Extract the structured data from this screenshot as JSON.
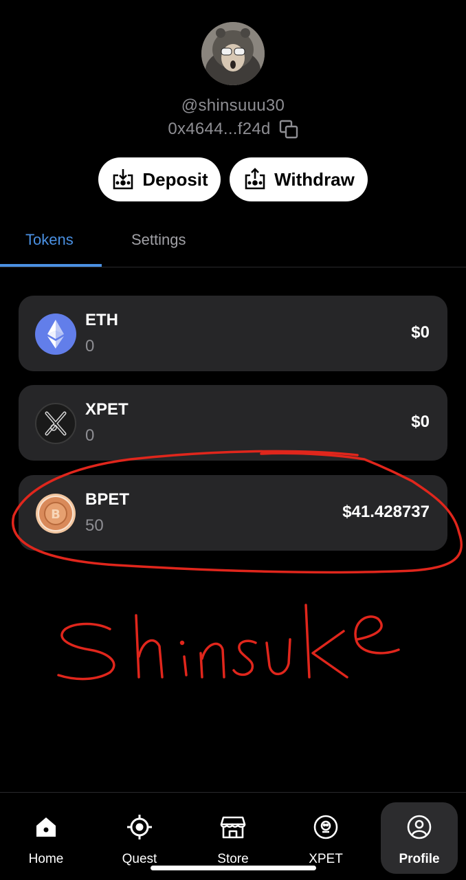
{
  "profile": {
    "username": "@shinsuuu30",
    "address": "0x4644...f24d"
  },
  "actions": {
    "deposit_label": "Deposit",
    "withdraw_label": "Withdraw"
  },
  "tabs": [
    {
      "label": "Tokens",
      "active": true
    },
    {
      "label": "Settings",
      "active": false
    }
  ],
  "tokens": [
    {
      "symbol": "ETH",
      "amount": "0",
      "value": "$0",
      "icon": "ethereum-icon"
    },
    {
      "symbol": "XPET",
      "amount": "0",
      "value": "$0",
      "icon": "xpet-icon"
    },
    {
      "symbol": "BPET",
      "amount": "50",
      "value": "$41.428737",
      "icon": "bpet-coin-icon"
    }
  ],
  "annotation": {
    "handwritten_text": "Shinsuke",
    "color": "#e0261c"
  },
  "nav": [
    {
      "label": "Home",
      "icon": "home-icon",
      "active": false
    },
    {
      "label": "Quest",
      "icon": "target-icon",
      "active": false
    },
    {
      "label": "Store",
      "icon": "store-icon",
      "active": false
    },
    {
      "label": "XPET",
      "icon": "xpet-face-icon",
      "active": false
    },
    {
      "label": "Profile",
      "icon": "profile-icon",
      "active": true
    }
  ],
  "colors": {
    "accent": "#4a90e2",
    "card": "#262628",
    "muted_text": "#8e8e93"
  }
}
